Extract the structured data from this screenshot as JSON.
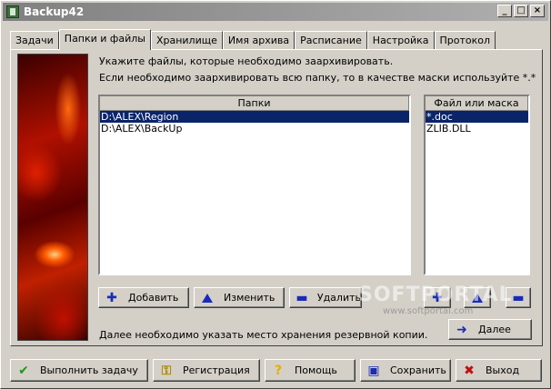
{
  "window": {
    "title": "Backup42",
    "min": "_",
    "max": "□",
    "close": "×"
  },
  "tabs": [
    {
      "label": "Задачи"
    },
    {
      "label": "Папки и файлы"
    },
    {
      "label": "Хранилище"
    },
    {
      "label": "Имя архива"
    },
    {
      "label": "Расписание"
    },
    {
      "label": "Настройка"
    },
    {
      "label": "Протокол"
    }
  ],
  "active_tab": 1,
  "instructions": {
    "line1": "Укажите файлы, которые необходимо заархивировать.",
    "line2": "Если необходимо заархивировать всю папку, то в качестве маски используйте *.*"
  },
  "folders": {
    "header": "Папки",
    "items": [
      "D:\\ALEX\\Region",
      "D:\\ALEX\\BackUp"
    ],
    "selected": 0,
    "add": "Добавить",
    "edit": "Изменить",
    "delete": "Удалить"
  },
  "masks": {
    "header": "Файл или маска",
    "items": [
      "*.doc",
      "ZLIB.DLL"
    ],
    "selected": 0
  },
  "next_note": "Далее необходимо указать место хранения резервной копии.",
  "next_button": "Далее",
  "bottom": {
    "run": "Выполнить задачу",
    "register": "Регистрация",
    "help": "Помощь",
    "save": "Сохранить",
    "exit": "Выход"
  },
  "watermark": {
    "text": "SOFTPORTAL",
    "url": "www.softportal.com"
  }
}
